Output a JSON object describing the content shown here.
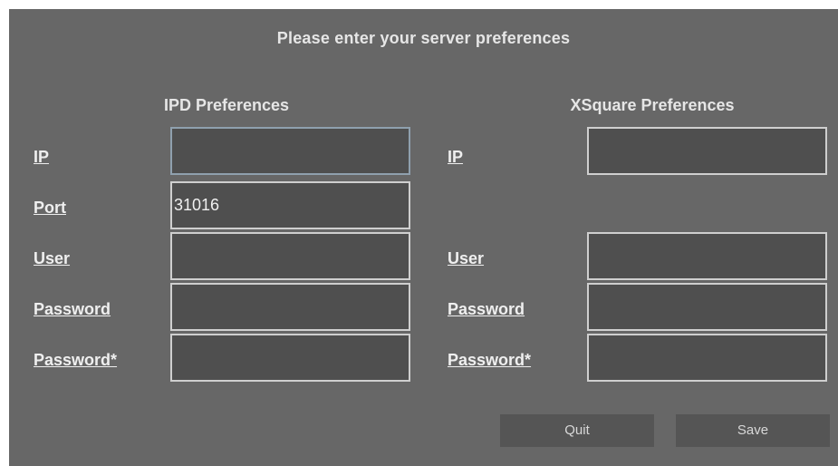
{
  "header": {
    "title": "Please enter your server preferences"
  },
  "ipd": {
    "title": "IPD Preferences",
    "ip_label": "IP",
    "ip_value": "",
    "port_label": "Port",
    "port_value": "31016",
    "user_label": "User",
    "user_value": "",
    "password_label": "Password",
    "password_value": "",
    "password_confirm_label": "Password",
    "password_confirm_value": ""
  },
  "xsquare": {
    "title": "XSquare Preferences",
    "ip_label": "IP",
    "ip_value": "",
    "user_label": "User",
    "user_value": "",
    "password_label": "Password",
    "password_value": "",
    "password_confirm_label": "Password",
    "password_confirm_value": ""
  },
  "required_mark": "*",
  "buttons": {
    "quit": "Quit",
    "save": "Save"
  },
  "colors": {
    "background": "#676767",
    "field": "#4f4f4f",
    "field_border": "#cfcfcf",
    "focus_border": "#8fa0ae",
    "button": "#555555"
  }
}
